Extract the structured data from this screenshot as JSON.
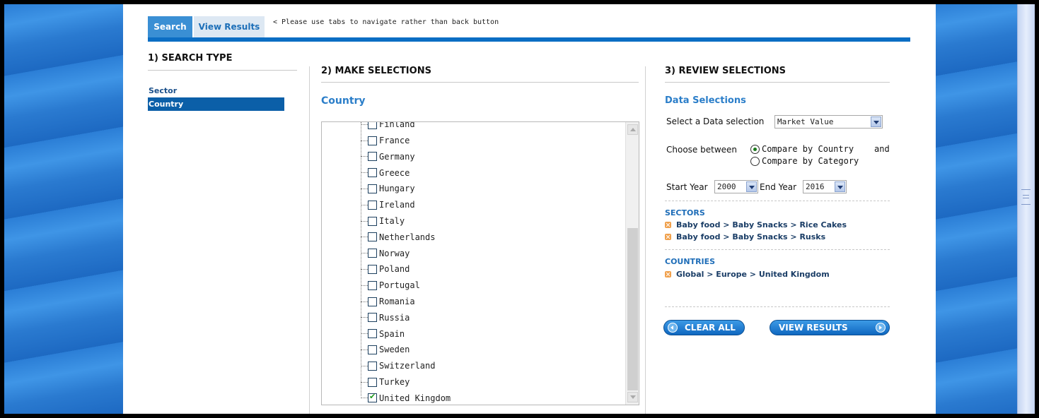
{
  "tabs": {
    "search": "Search",
    "view_results": "View Results",
    "note": "< Please use tabs to navigate rather than back button"
  },
  "search_type": {
    "title": "1) SEARCH TYPE",
    "items": [
      "Sector",
      "Country"
    ],
    "selected": "Country"
  },
  "make_selections": {
    "title": "2) MAKE SELECTIONS",
    "subtitle": "Country",
    "partial_item": "Finland",
    "countries": [
      {
        "name": "France",
        "checked": false
      },
      {
        "name": "Germany",
        "checked": false
      },
      {
        "name": "Greece",
        "checked": false
      },
      {
        "name": "Hungary",
        "checked": false
      },
      {
        "name": "Ireland",
        "checked": false
      },
      {
        "name": "Italy",
        "checked": false
      },
      {
        "name": "Netherlands",
        "checked": false
      },
      {
        "name": "Norway",
        "checked": false
      },
      {
        "name": "Poland",
        "checked": false
      },
      {
        "name": "Portugal",
        "checked": false
      },
      {
        "name": "Romania",
        "checked": false
      },
      {
        "name": "Russia",
        "checked": false
      },
      {
        "name": "Spain",
        "checked": false
      },
      {
        "name": "Sweden",
        "checked": false
      },
      {
        "name": "Switzerland",
        "checked": false
      },
      {
        "name": "Turkey",
        "checked": false
      },
      {
        "name": "United Kingdom",
        "checked": true
      }
    ]
  },
  "review": {
    "title": "3) REVIEW SELECTIONS",
    "subtitle": "Data Selections",
    "data_selection_label": "Select a Data selection",
    "data_selection_value": "Market Value",
    "choose_label": "Choose between",
    "compare_country": "Compare by Country",
    "and_label": "and",
    "compare_category": "Compare by Category",
    "compare_selected": "country",
    "start_year_label": "Start Year",
    "start_year": "2000",
    "end_year_label": "End Year",
    "end_year": "2016",
    "sectors_label": "SECTORS",
    "sectors": [
      "Baby food > Baby Snacks > Rice Cakes",
      "Baby food > Baby Snacks > Rusks"
    ],
    "countries_label": "COUNTRIES",
    "countries": [
      "Global > Europe > United Kingdom"
    ],
    "clear_all": "CLEAR ALL",
    "view_results": "VIEW RESULTS"
  },
  "colors": {
    "accent": "#0b6ec4",
    "selected_bg": "#0b5fa8",
    "subhead": "#2b7ec9",
    "remove_icon": "#f0a04b"
  }
}
